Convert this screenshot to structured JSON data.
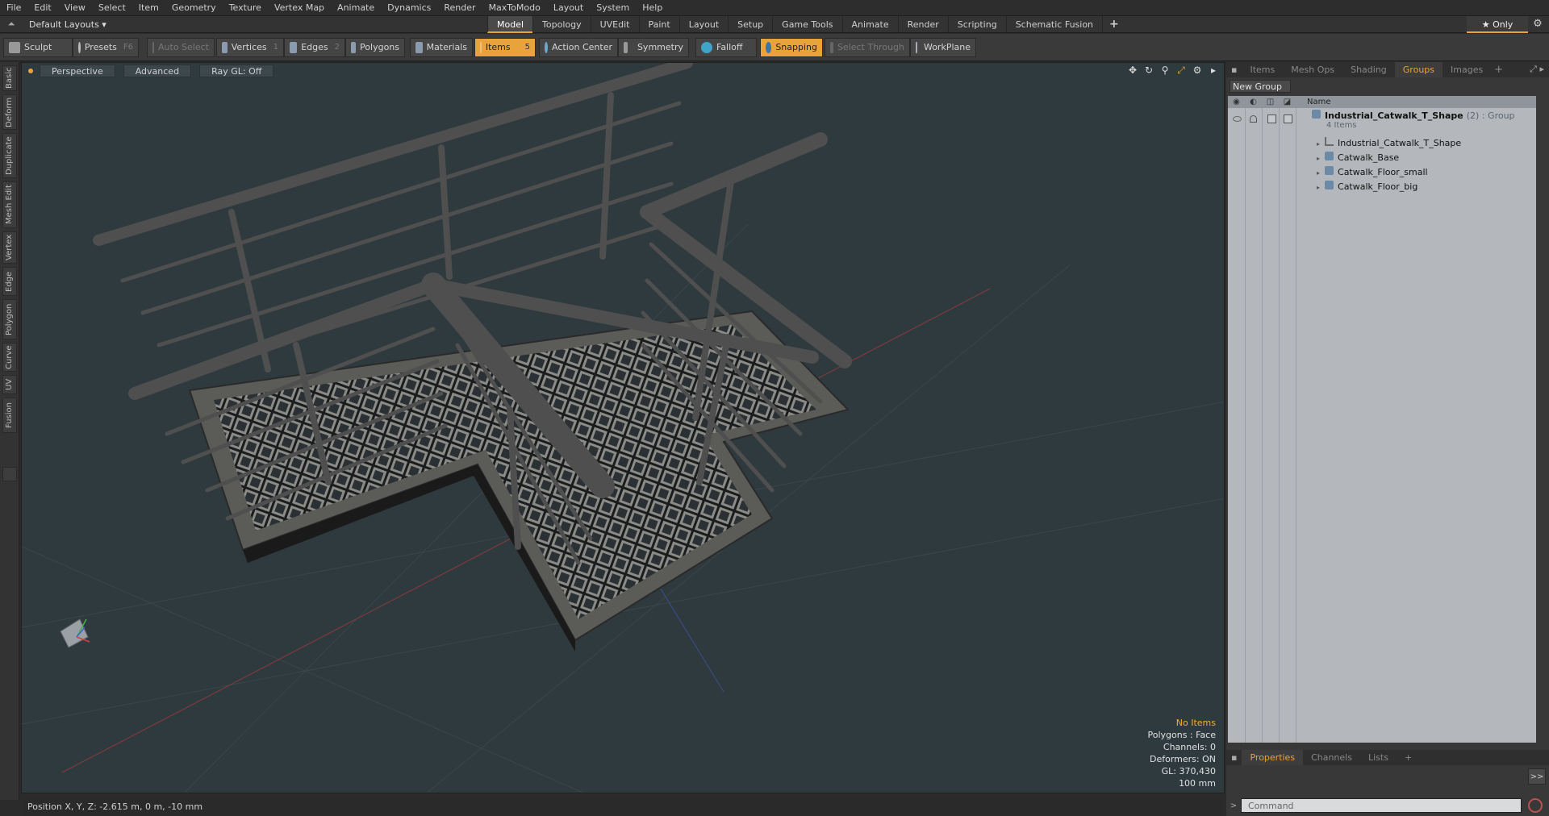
{
  "menu": [
    "File",
    "Edit",
    "View",
    "Select",
    "Item",
    "Geometry",
    "Texture",
    "Vertex Map",
    "Animate",
    "Dynamics",
    "Render",
    "MaxToModo",
    "Layout",
    "System",
    "Help"
  ],
  "layout": {
    "layouts_label": "Default Layouts ▾",
    "tabs": [
      "Model",
      "Topology",
      "UVEdit",
      "Paint",
      "Layout",
      "Setup",
      "Game Tools",
      "Animate",
      "Render",
      "Scripting",
      "Schematic Fusion"
    ],
    "active_tab": "Model",
    "plus": "+",
    "only_label": "★  Only"
  },
  "toolbar": {
    "sculpt": "Sculpt",
    "presets": "Presets",
    "presets_key": "F6",
    "auto_select": "Auto Select",
    "vertices": "Vertices",
    "vertices_key": "1",
    "edges": "Edges",
    "edges_key": "2",
    "polygons": "Polygons",
    "materials": "Materials",
    "items": "Items",
    "items_key": "5",
    "action_center": "Action Center",
    "symmetry": "Symmetry",
    "falloff": "Falloff",
    "snapping": "Snapping",
    "select_through": "Select Through",
    "workplane": "WorkPlane"
  },
  "left_tabs": [
    "Basic",
    "Deform",
    "Duplicate",
    "Mesh Edit",
    "Vertex",
    "Edge",
    "Polygon",
    "Curve",
    "UV",
    "Fusion"
  ],
  "viewport": {
    "view_mode": "Perspective",
    "shading": "Advanced",
    "raygl": "Ray GL: Off",
    "info": {
      "no_items": "No Items",
      "polygons": "Polygons : Face",
      "channels": "Channels: 0",
      "deformers": "Deformers: ON",
      "gl": "GL: 370,430",
      "grid": "100 mm"
    }
  },
  "status": {
    "position": "Position X, Y, Z:  -2.615 m, 0 m, -10 mm"
  },
  "right_panel": {
    "tabs": [
      "Items",
      "Mesh Ops",
      "Shading",
      "Groups",
      "Images"
    ],
    "active_tab": "Groups",
    "new_group": "New Group",
    "name_header": "Name",
    "group": {
      "name": "Industrial_Catwalk_T_Shape",
      "count_tag": "(2) : Group",
      "items_count": "4 Items",
      "children": [
        {
          "name": "Industrial_Catwalk_T_Shape",
          "icon": "locator-icon"
        },
        {
          "name": "Catwalk_Base",
          "icon": "mesh-icon"
        },
        {
          "name": "Catwalk_Floor_small",
          "icon": "mesh-icon"
        },
        {
          "name": "Catwalk_Floor_big",
          "icon": "mesh-icon"
        }
      ]
    },
    "bottom_tabs": [
      "Properties",
      "Channels",
      "Lists"
    ],
    "bottom_active": "Properties",
    "expand": ">>",
    "command_placeholder": "Command"
  },
  "colors": {
    "accent": "#e8a33a",
    "viewport_bg": "#2f3a3f",
    "list_bg": "#b4b8bc"
  }
}
